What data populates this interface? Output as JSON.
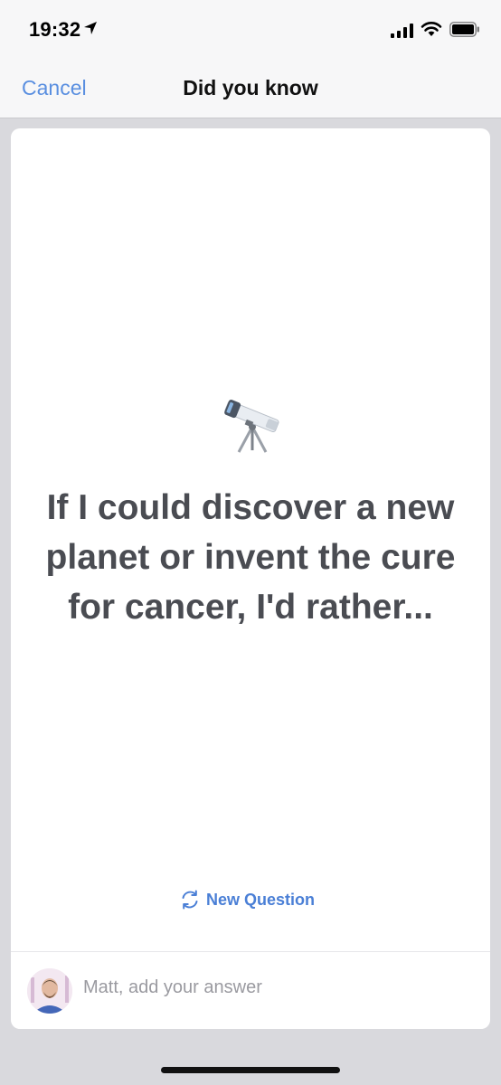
{
  "status_bar": {
    "time": "19:32"
  },
  "nav": {
    "cancel_label": "Cancel",
    "title": "Did you know"
  },
  "card": {
    "emoji_icon": "telescope-icon",
    "question": "If I could discover a new planet or invent the cure for cancer, I'd rather...",
    "new_question_label": "New Question"
  },
  "answer": {
    "placeholder": "Matt, add your answer"
  },
  "colors": {
    "accent": "#4a7fd6",
    "question_text": "#4a4c52",
    "background": "#d9d9dd"
  }
}
